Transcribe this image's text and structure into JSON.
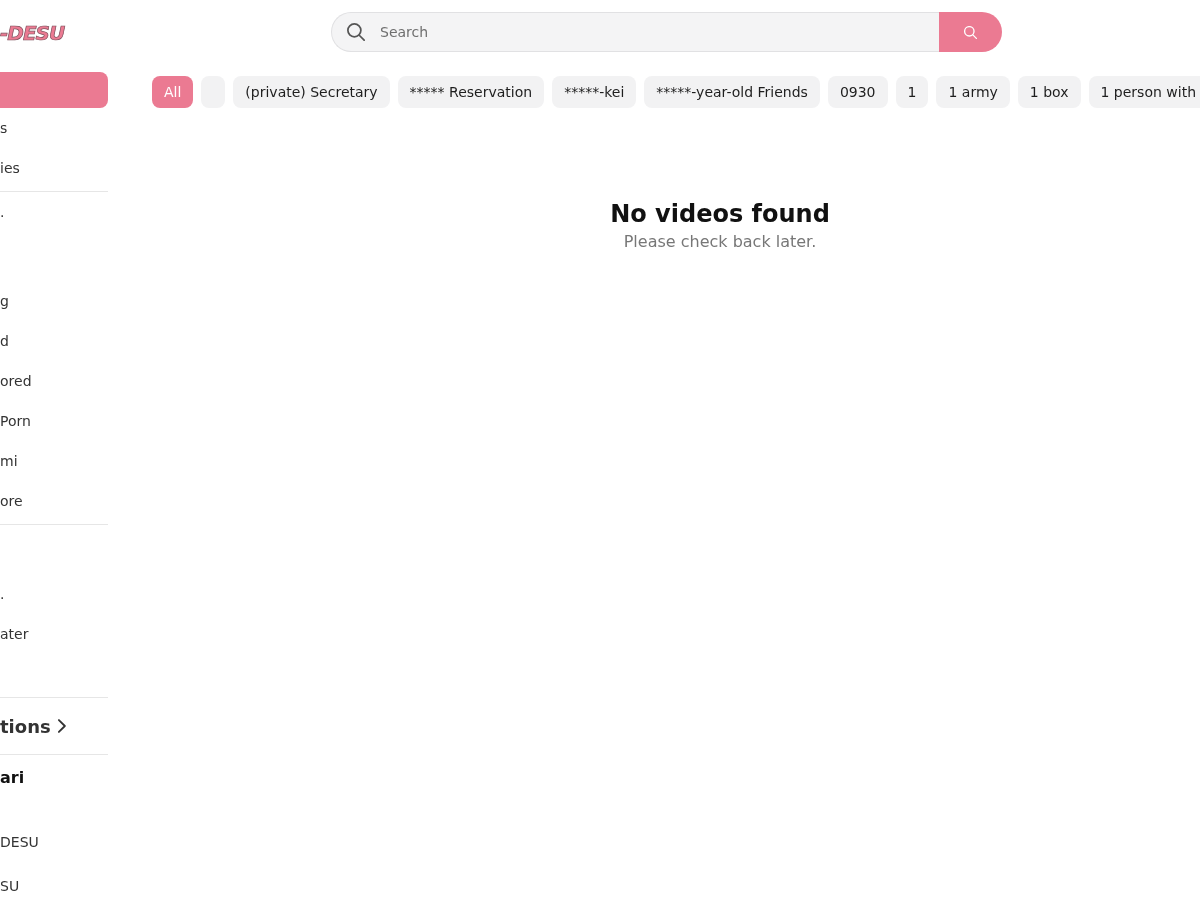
{
  "logo": {
    "text": "-DESU"
  },
  "search": {
    "placeholder": "Search"
  },
  "sidebar": {
    "sections": [
      {
        "kind": "list",
        "items": [
          {
            "selected": true
          },
          {
            "label": "s",
            "selected": false
          },
          {
            "label": "ies",
            "selected": false
          }
        ]
      },
      {
        "kind": "list",
        "items": [
          {
            "label": ".",
            "selected": false
          },
          {
            "label": "g",
            "selected": false
          },
          {
            "label": "d",
            "selected": false
          },
          {
            "label": "ored",
            "selected": false
          },
          {
            "label": "Porn",
            "selected": false
          },
          {
            "label": "mi",
            "selected": false
          },
          {
            "label": "ore",
            "selected": false
          }
        ]
      },
      {
        "kind": "list",
        "items": [
          {
            "label": ".",
            "selected": false
          },
          {
            "label": "ater",
            "selected": false
          }
        ]
      },
      {
        "kind": "link_heading",
        "title": "tions"
      },
      {
        "kind": "group",
        "title": "ari",
        "items": [
          {
            "label": "DESU",
            "selected": false
          },
          {
            "label": "SU",
            "selected": false
          }
        ]
      }
    ]
  },
  "chips": [
    {
      "label": "All",
      "selected": true
    },
    {
      "selected": false
    },
    {
      "label": "(private) Secretary",
      "selected": false
    },
    {
      "label": "***** Reservation",
      "selected": false
    },
    {
      "label": "*****-kei",
      "selected": false
    },
    {
      "label": "*****-year-old Friends",
      "selected": false
    },
    {
      "label": "0930",
      "selected": false
    },
    {
      "label": "1",
      "selected": false
    },
    {
      "label": "1 army",
      "selected": false
    },
    {
      "label": "1 box",
      "selected": false
    },
    {
      "label": "1 person with",
      "selected": false
    }
  ],
  "empty_state": {
    "title": "No videos found",
    "message": "Please check back later."
  }
}
